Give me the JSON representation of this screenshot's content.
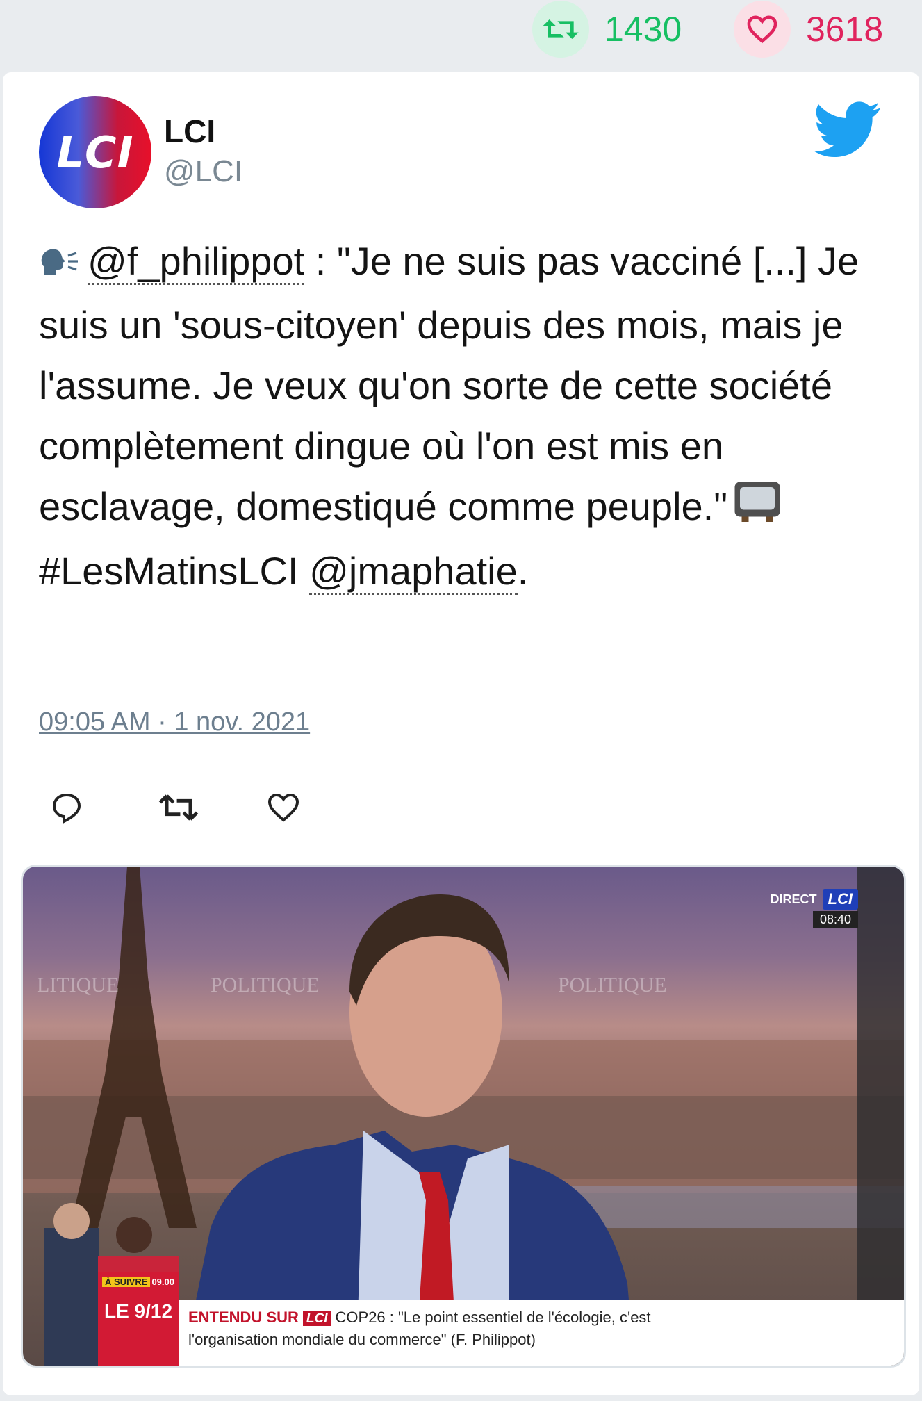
{
  "stats": {
    "retweets": "1430",
    "likes": "3618",
    "retweet_color": "#17bf63",
    "like_color": "#e0245e"
  },
  "tweet": {
    "author_name": "LCI",
    "author_handle": "@LCI",
    "avatar_text": "LCI",
    "text_parts": {
      "mention1": "@f_philippot",
      "body": " : \"Je ne suis pas vacciné [...] Je suis un 'sous-citoyen' depuis des mois, mais je l'assume. Je veux qu'on sorte de cette société complètement dingue où l'on est mis en esclavage, domestiqué comme peuple.\"",
      "hashtag": "#LesMatinsLCI",
      "mention2": "@jmaphatie",
      "tail": "."
    },
    "timestamp": "09:05 AM · 1 nov. 2021"
  },
  "media": {
    "bug_direct": "DIRECT",
    "bug_logo": "LCI",
    "bug_time": "08:40",
    "promo_tag": "À SUIVRE",
    "promo_time": "09.00",
    "promo_title": "LE 9/12",
    "caption_tag": "ENTENDU SUR",
    "caption_logo": "LCI",
    "caption_line1": "COP26 : \"Le point essentiel de l'écologie, c'est",
    "caption_line2": "l'organisation mondiale du commerce\" (F. Philippot)"
  },
  "icons": [
    "retweet-icon",
    "heart-icon",
    "twitter-bird-icon",
    "speaking-head-icon",
    "television-icon",
    "reply-icon",
    "retweet-action-icon",
    "like-action-icon"
  ],
  "brand_color": "#1da1f2"
}
